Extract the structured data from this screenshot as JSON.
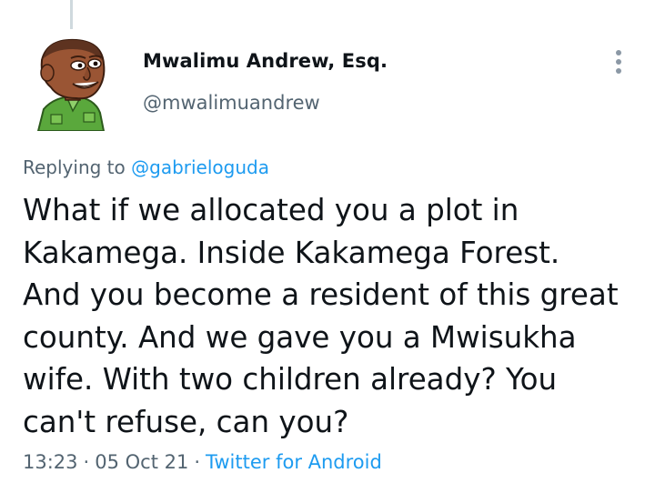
{
  "tweet": {
    "author": {
      "display_name": "Mwalimu Andrew, Esq.",
      "handle": "@mwalimuandrew",
      "avatar_icon": "cartoon-man-avatar"
    },
    "more_icon": "more-vertical-icon",
    "replying_prefix": "Replying to",
    "replying_to": "@gabrieloguda",
    "text_lines": [
      "What if we allocated you a plot in",
      "Kakamega. Inside Kakamega Forest.",
      "And you become a resident of this great",
      "county. And we gave you a Mwisukha",
      "wife. With two children already? You",
      "can't refuse, can you?"
    ],
    "time": "13:23",
    "date": "05 Oct 21",
    "source": "Twitter for Android",
    "separator": "·"
  },
  "colors": {
    "text_primary": "#0f1419",
    "text_secondary": "#536471",
    "link": "#1d9bf0",
    "thread_line": "#cfd9de"
  }
}
